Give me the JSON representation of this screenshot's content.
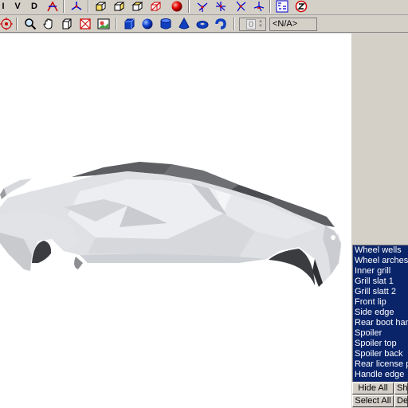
{
  "toolbar_top": {
    "buttons": [
      {
        "name": "view-v-button",
        "label": "V"
      },
      {
        "name": "view-d-button",
        "label": "D"
      }
    ]
  },
  "toolbar_bottom": {
    "spinner_value": "0",
    "selection_field": "<N/A>"
  },
  "selection_panel": {
    "items": [
      "Wheel wells",
      "Wheel arches",
      "Inner grill",
      "Grill slat 1",
      "Grill slatt 2",
      "Front lip",
      "Side edge",
      "Rear boot handle",
      "Spoiler",
      "Spoiler top",
      "Spoiler back",
      "Rear license plate",
      "Handle edge"
    ],
    "hide_all_label": "Hide All",
    "show_label": "Sh",
    "select_all_label": "Select All",
    "deselect_label": "De"
  },
  "colors": {
    "selection_bg": "#0a246a",
    "toolbar_bg": "#d4d0c8",
    "viewport_bg": "#ffffff",
    "model_light": "#e4e6ea",
    "model_dark": "#5a5c60"
  }
}
